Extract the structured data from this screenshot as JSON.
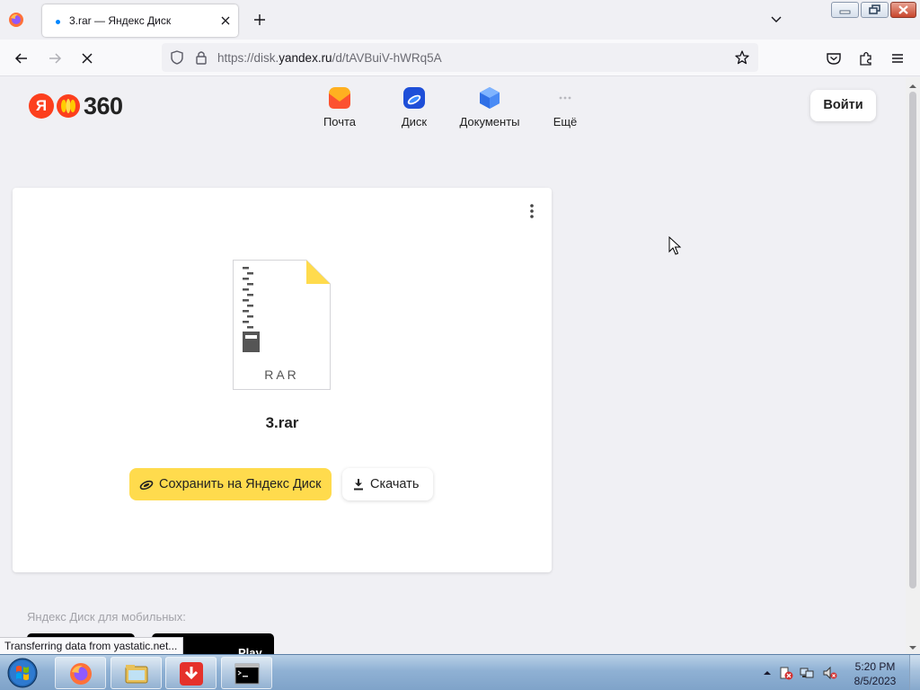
{
  "browser": {
    "tab": {
      "title": "3.rar — Яндекс Диск"
    },
    "url": {
      "prefix": "https://disk.",
      "domain": "yandex.ru",
      "path": "/d/tAVBuiV-hWRq5A"
    },
    "status_text": "Transferring data from yastatic.net...",
    "icons": [
      "firefox-menu-icon",
      "close-tab-icon",
      "new-tab-icon",
      "tab-list-icon",
      "back-icon",
      "forward-icon",
      "stop-loading-icon",
      "shield-icon",
      "lock-icon",
      "bookmark-star-icon",
      "pocket-icon",
      "extensions-icon",
      "hamburger-menu-icon"
    ]
  },
  "header": {
    "logo_letter": "Я",
    "logo_text": "360",
    "services": [
      {
        "label": "Почта",
        "icon": "mail-icon",
        "color": "#fc3f1d"
      },
      {
        "label": "Диск",
        "icon": "disk-icon",
        "color": "#0a62d6"
      },
      {
        "label": "Документы",
        "icon": "documents-icon",
        "color": "#3a86ff"
      },
      {
        "label": "Ещё",
        "icon": "more-icon",
        "color": "#c4c4c8"
      }
    ],
    "login_label": "Войти"
  },
  "file": {
    "type_label": "RAR",
    "name": "3.rar",
    "save_label": "Сохранить на Яндекс Диск",
    "download_label": "Скачать"
  },
  "footer": {
    "mobile_text": "Яндекс Диск для мобильных:",
    "badge_partial_text": "Play"
  },
  "taskbar": {
    "apps": [
      "firefox-icon",
      "file-explorer-icon",
      "download-app-icon",
      "command-prompt-icon"
    ],
    "clock": {
      "time": "5:20 PM",
      "date": "8/5/2023"
    }
  },
  "colors": {
    "accent_yellow": "#ffdb4d",
    "yandex_red": "#fc3f1d",
    "link_blue": "#0086ff"
  }
}
